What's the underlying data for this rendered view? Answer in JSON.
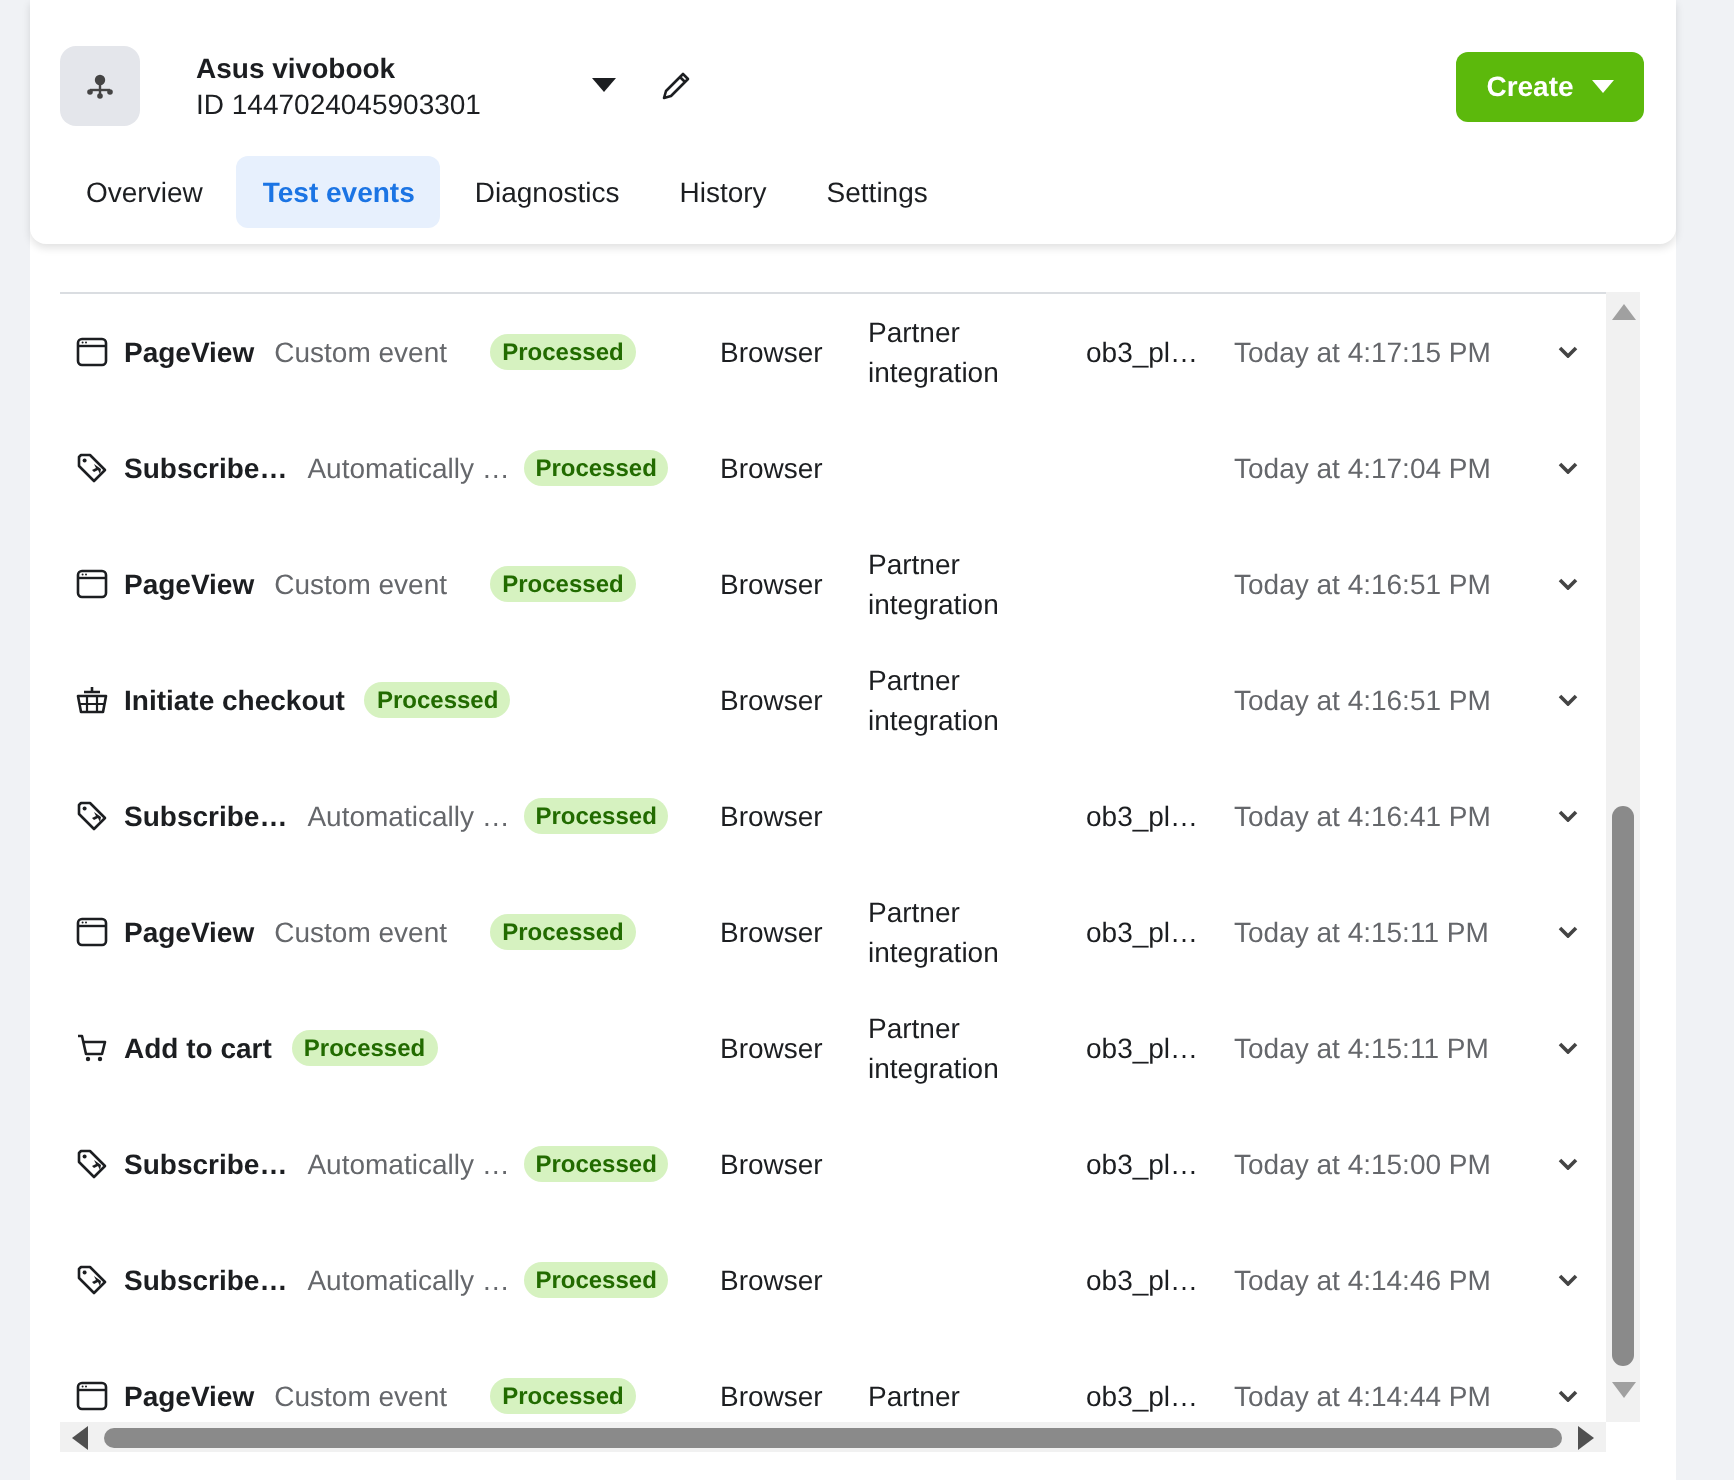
{
  "dataset": {
    "name": "Asus vivobook",
    "id": "ID 1447024045903301"
  },
  "create_button": {
    "label": "Create"
  },
  "tabs": [
    {
      "label": "Overview",
      "selected": false
    },
    {
      "label": "Test events",
      "selected": true
    },
    {
      "label": "Diagnostics",
      "selected": false
    },
    {
      "label": "History",
      "selected": false
    },
    {
      "label": "Settings",
      "selected": false
    }
  ],
  "events": [
    {
      "kind": "page",
      "name": "PageView",
      "subtitle": "Custom event",
      "status": "Processed",
      "channel": "Browser",
      "source": "Partner integration",
      "parameter": "ob3_pl…",
      "time": "Today at 4:17:15 PM"
    },
    {
      "kind": "subscribe",
      "name": "Subscribe…",
      "subtitle": "Automatically …",
      "status": "Processed",
      "channel": "Browser",
      "time": "Today at 4:17:04 PM"
    },
    {
      "kind": "page",
      "name": "PageView",
      "subtitle": "Custom event",
      "status": "Processed",
      "channel": "Browser",
      "source": "Partner integration",
      "time": "Today at 4:16:51 PM"
    },
    {
      "kind": "checkout",
      "name": "Initiate checkout",
      "status": "Processed",
      "channel": "Browser",
      "source": "Partner integration",
      "time": "Today at 4:16:51 PM"
    },
    {
      "kind": "subscribe",
      "name": "Subscribe…",
      "subtitle": "Automatically …",
      "status": "Processed",
      "channel": "Browser",
      "parameter": "ob3_pl…",
      "time": "Today at 4:16:41 PM"
    },
    {
      "kind": "page",
      "name": "PageView",
      "subtitle": "Custom event",
      "status": "Processed",
      "channel": "Browser",
      "source": "Partner integration",
      "parameter": "ob3_pl…",
      "time": "Today at 4:15:11 PM"
    },
    {
      "kind": "cart",
      "name": "Add to cart",
      "status": "Processed",
      "channel": "Browser",
      "source": "Partner integration",
      "parameter": "ob3_pl…",
      "time": "Today at 4:15:11 PM"
    },
    {
      "kind": "subscribe",
      "name": "Subscribe…",
      "subtitle": "Automatically …",
      "status": "Processed",
      "channel": "Browser",
      "parameter": "ob3_pl…",
      "time": "Today at 4:15:00 PM"
    },
    {
      "kind": "subscribe",
      "name": "Subscribe…",
      "subtitle": "Automatically …",
      "status": "Processed",
      "channel": "Browser",
      "parameter": "ob3_pl…",
      "time": "Today at 4:14:46 PM"
    },
    {
      "kind": "page",
      "name": "PageView",
      "subtitle": "Custom event",
      "status": "Processed",
      "channel": "Browser",
      "source": "Partner",
      "parameter": "ob3_pl…",
      "time": "Today at 4:14:44 PM"
    }
  ]
}
